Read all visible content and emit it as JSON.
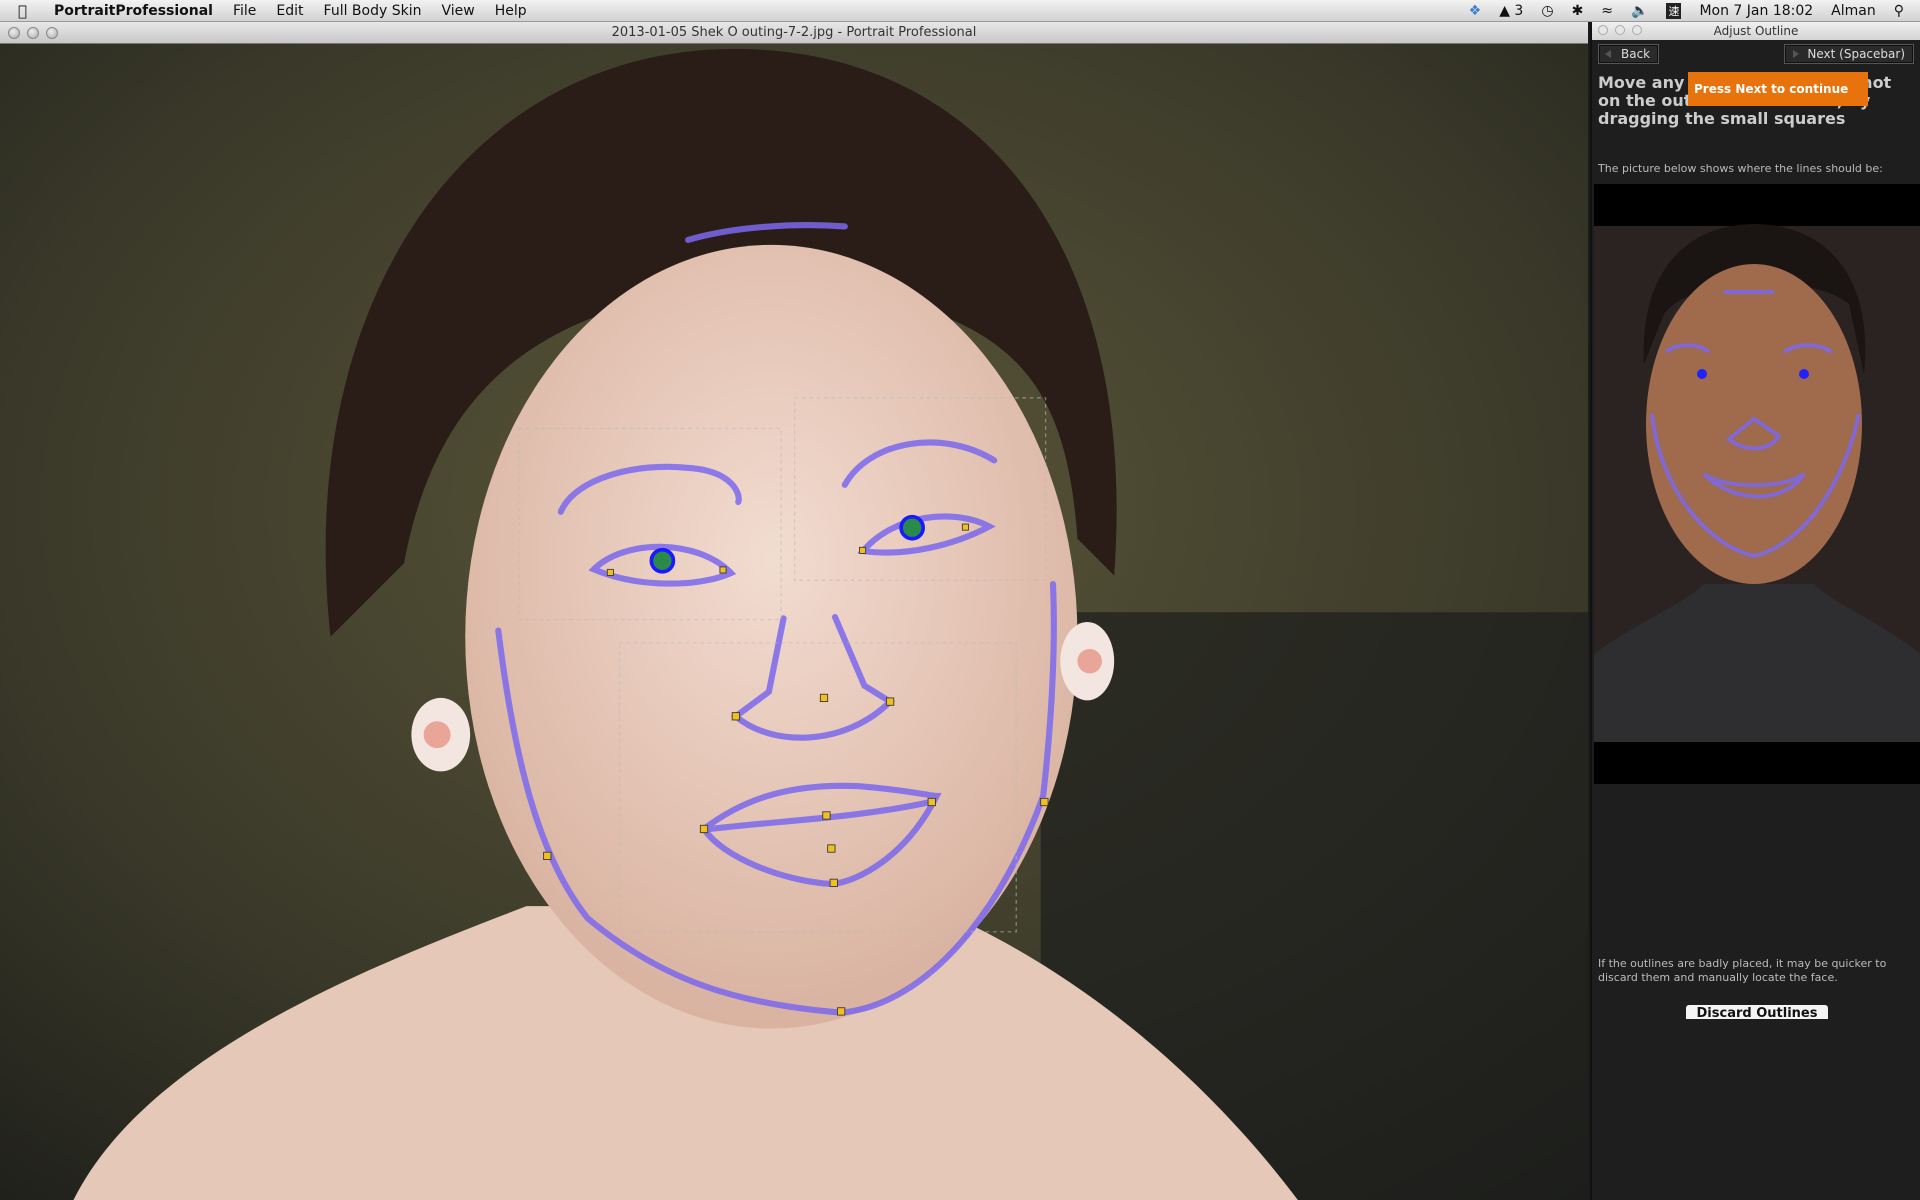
{
  "menubar": {
    "app": "PortraitProfessional",
    "items": [
      "File",
      "Edit",
      "Full Body Skin",
      "View",
      "Help"
    ],
    "status": {
      "adobe_count": "3",
      "datetime": "Mon 7 Jan  18:02",
      "user": "Alman"
    }
  },
  "window": {
    "title": "2013-01-05 Shek O outing-7-2.jpg - Portrait Professional"
  },
  "panel": {
    "title": "Adjust Outline",
    "back_label": "Back",
    "next_label": "Next (Spacebar)",
    "heading": "Move any blue lines that are not on the outlines of the face, by dragging the small squares",
    "tooltip": "Press Next to continue",
    "subtext": "The picture below shows where the lines should be:",
    "bottom_text": "If the outlines are badly placed, it may be quicker to discard them and manually locate the face.",
    "discard_label": "Discard Outlines"
  },
  "colors": {
    "outline": "#7b68ee",
    "accent": "#e8720c",
    "handle": "#f0c020"
  }
}
